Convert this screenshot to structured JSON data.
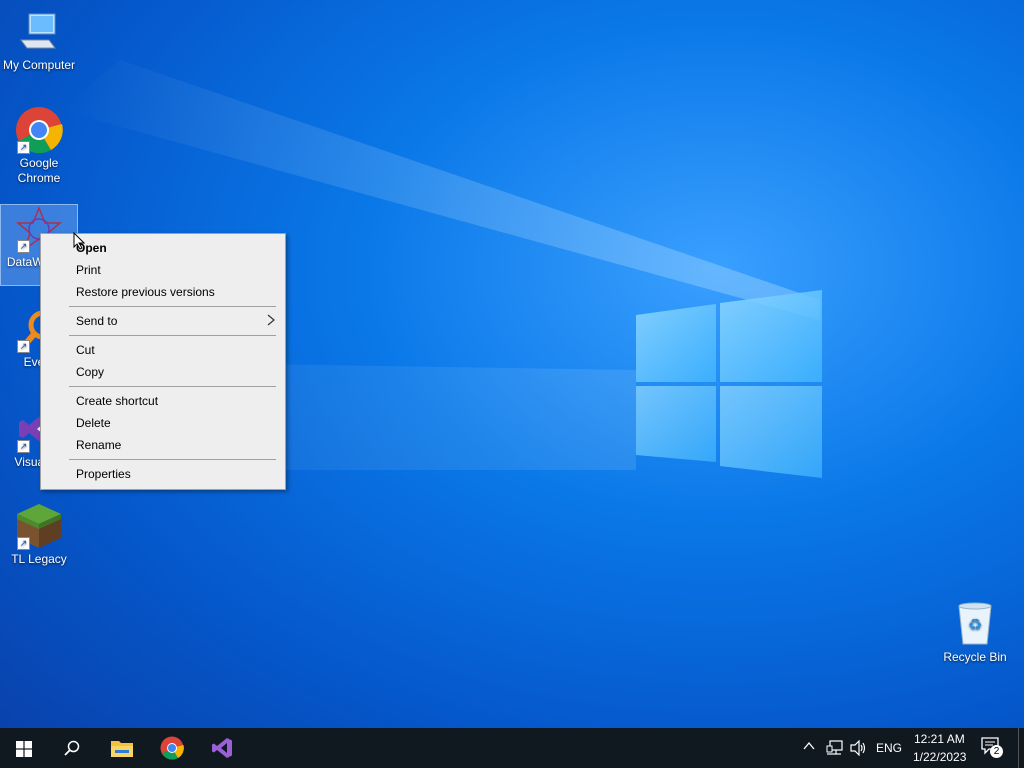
{
  "desktop": {
    "icons": [
      {
        "label": "My Computer"
      },
      {
        "label": "Google Chrome"
      },
      {
        "label": "DataWarrior"
      },
      {
        "label": "Every"
      },
      {
        "label": "Visual 20"
      },
      {
        "label": "TL Legacy"
      },
      {
        "label": "Recycle Bin"
      }
    ]
  },
  "context_menu": {
    "items": [
      {
        "label": "Open"
      },
      {
        "label": "Print"
      },
      {
        "label": "Restore previous versions"
      },
      {
        "label": "Send to"
      },
      {
        "label": "Cut"
      },
      {
        "label": "Copy"
      },
      {
        "label": "Create shortcut"
      },
      {
        "label": "Delete"
      },
      {
        "label": "Rename"
      },
      {
        "label": "Properties"
      }
    ]
  },
  "taskbar": {
    "language": "ENG",
    "time": "12:21 AM",
    "date": "1/22/2023",
    "notifications_count": "2"
  },
  "colors": {
    "taskbar_bg": "#101820",
    "menu_bg": "#eeeeee",
    "desktop_accent": "#0a78e8"
  }
}
